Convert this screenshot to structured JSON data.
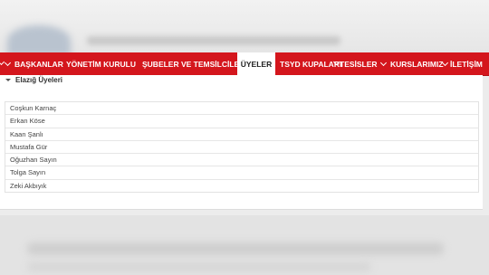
{
  "nav": {
    "items": [
      {
        "label": "BAŞKANLAR",
        "chevron": true
      },
      {
        "label": "YÖNETİM KURULU",
        "chevron": false
      },
      {
        "label": "ŞUBELER VE TEMSİLCİLER",
        "chevron": false
      },
      {
        "label": "ÜYELER",
        "chevron": false,
        "active": true
      },
      {
        "label": "TSYD KUPALARI",
        "chevron": false
      },
      {
        "label": "TESİSLER",
        "chevron": true
      },
      {
        "label": "KURSLARIMIZ",
        "chevron": true
      },
      {
        "label": "İLETİŞİM",
        "chevron": false
      }
    ]
  },
  "section": {
    "title": "Elazığ Üyeleri"
  },
  "members": [
    "Coşkun Karnaç",
    "Erkan Köse",
    "Kaan Şanlı",
    "Mustafa Gür",
    "Oğuzhan Sayın",
    "Tolga Sayın",
    "Zeki Akbıyık"
  ],
  "colors": {
    "nav_bg": "#d4161d",
    "nav_text": "#ffffff",
    "active_bg": "#ffffff",
    "page_bg": "#ececec"
  }
}
